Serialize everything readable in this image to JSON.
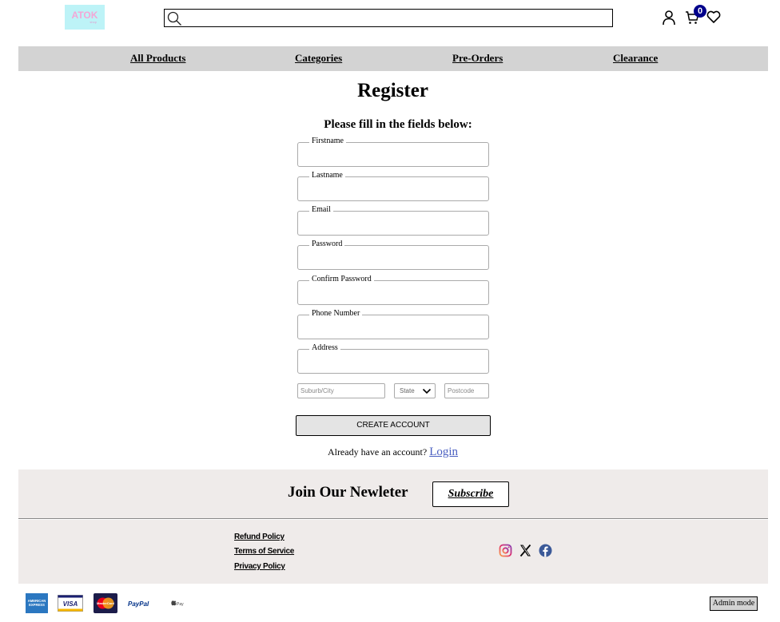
{
  "header": {
    "logo_text": "ATOK",
    "logo_sub": "shop",
    "cart_count": "0",
    "search_value": ""
  },
  "nav": {
    "items": [
      "All Products",
      "Categories",
      "Pre-Orders",
      "Clearance"
    ]
  },
  "register": {
    "title": "Register",
    "subtitle": "Please fill in the fields below:",
    "fields": [
      "Firstname",
      "Lastname",
      "Email",
      "Password",
      "Confirm Password",
      "Phone Number",
      "Address"
    ],
    "suburb_placeholder": "Suburb/City",
    "state_value": "State",
    "postcode_placeholder": "Postcode",
    "create_button": "CREATE ACCOUNT",
    "already_text": "Already have an account?",
    "login_link": "Login"
  },
  "newsletter": {
    "title": "Join Our Newleter",
    "subscribe_label": "Subscribe"
  },
  "footer": {
    "policies": [
      "Refund Policy",
      "Terms of Service",
      "Privacy Policy"
    ],
    "social": [
      "instagram-icon",
      "x-icon",
      "facebook-icon"
    ]
  },
  "payments": {
    "methods": [
      "AMERICAN EXPRESS",
      "VISA",
      "MasterCard",
      "PayPal",
      "Pay"
    ]
  },
  "admin": {
    "label": "Admin mode"
  },
  "colors": {
    "nav_bg": "#d3d3d3",
    "footer_bg": "#efebea",
    "badge": "#00008b",
    "link": "#4a5fc1",
    "logo_bg": "#bdf3f7"
  }
}
